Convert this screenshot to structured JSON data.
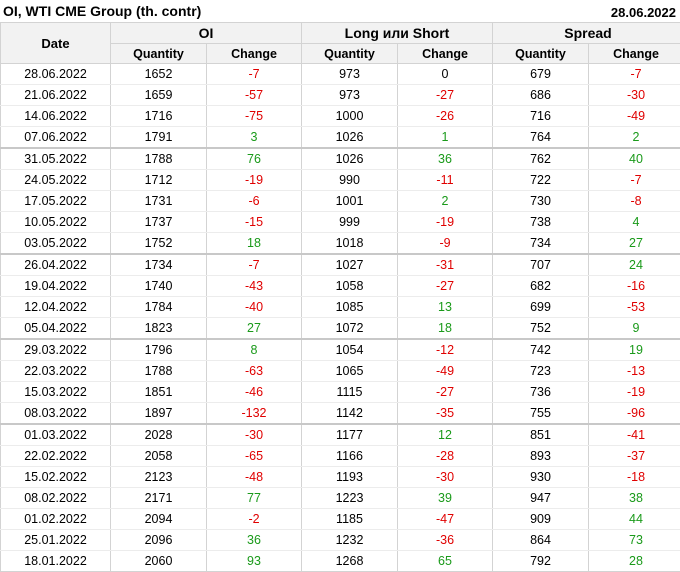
{
  "title": "OI, WTI CME Group (th. contr)",
  "date": "28.06.2022",
  "headers": {
    "date": "Date",
    "groups": [
      "OI",
      "Long или Short",
      "Spread"
    ],
    "quantity": "Quantity",
    "change": "Change"
  },
  "colors": {
    "positive": "#1a9a1a",
    "negative": "#e00000"
  },
  "rows": [
    {
      "date": "28.06.2022",
      "oi_q": "1652",
      "oi_c": "-7",
      "ls_q": "973",
      "ls_c": "0",
      "sp_q": "679",
      "sp_c": "-7"
    },
    {
      "date": "21.06.2022",
      "oi_q": "1659",
      "oi_c": "-57",
      "ls_q": "973",
      "ls_c": "-27",
      "sp_q": "686",
      "sp_c": "-30"
    },
    {
      "date": "14.06.2022",
      "oi_q": "1716",
      "oi_c": "-75",
      "ls_q": "1000",
      "ls_c": "-26",
      "sp_q": "716",
      "sp_c": "-49"
    },
    {
      "date": "07.06.2022",
      "oi_q": "1791",
      "oi_c": "3",
      "ls_q": "1026",
      "ls_c": "1",
      "sp_q": "764",
      "sp_c": "2"
    },
    {
      "date": "31.05.2022",
      "oi_q": "1788",
      "oi_c": "76",
      "ls_q": "1026",
      "ls_c": "36",
      "sp_q": "762",
      "sp_c": "40",
      "sep": true
    },
    {
      "date": "24.05.2022",
      "oi_q": "1712",
      "oi_c": "-19",
      "ls_q": "990",
      "ls_c": "-11",
      "sp_q": "722",
      "sp_c": "-7"
    },
    {
      "date": "17.05.2022",
      "oi_q": "1731",
      "oi_c": "-6",
      "ls_q": "1001",
      "ls_c": "2",
      "sp_q": "730",
      "sp_c": "-8"
    },
    {
      "date": "10.05.2022",
      "oi_q": "1737",
      "oi_c": "-15",
      "ls_q": "999",
      "ls_c": "-19",
      "sp_q": "738",
      "sp_c": "4"
    },
    {
      "date": "03.05.2022",
      "oi_q": "1752",
      "oi_c": "18",
      "ls_q": "1018",
      "ls_c": "-9",
      "sp_q": "734",
      "sp_c": "27"
    },
    {
      "date": "26.04.2022",
      "oi_q": "1734",
      "oi_c": "-7",
      "ls_q": "1027",
      "ls_c": "-31",
      "sp_q": "707",
      "sp_c": "24",
      "sep": true
    },
    {
      "date": "19.04.2022",
      "oi_q": "1740",
      "oi_c": "-43",
      "ls_q": "1058",
      "ls_c": "-27",
      "sp_q": "682",
      "sp_c": "-16"
    },
    {
      "date": "12.04.2022",
      "oi_q": "1784",
      "oi_c": "-40",
      "ls_q": "1085",
      "ls_c": "13",
      "sp_q": "699",
      "sp_c": "-53"
    },
    {
      "date": "05.04.2022",
      "oi_q": "1823",
      "oi_c": "27",
      "ls_q": "1072",
      "ls_c": "18",
      "sp_q": "752",
      "sp_c": "9"
    },
    {
      "date": "29.03.2022",
      "oi_q": "1796",
      "oi_c": "8",
      "ls_q": "1054",
      "ls_c": "-12",
      "sp_q": "742",
      "sp_c": "19",
      "sep": true
    },
    {
      "date": "22.03.2022",
      "oi_q": "1788",
      "oi_c": "-63",
      "ls_q": "1065",
      "ls_c": "-49",
      "sp_q": "723",
      "sp_c": "-13"
    },
    {
      "date": "15.03.2022",
      "oi_q": "1851",
      "oi_c": "-46",
      "ls_q": "1115",
      "ls_c": "-27",
      "sp_q": "736",
      "sp_c": "-19"
    },
    {
      "date": "08.03.2022",
      "oi_q": "1897",
      "oi_c": "-132",
      "ls_q": "1142",
      "ls_c": "-35",
      "sp_q": "755",
      "sp_c": "-96"
    },
    {
      "date": "01.03.2022",
      "oi_q": "2028",
      "oi_c": "-30",
      "ls_q": "1177",
      "ls_c": "12",
      "sp_q": "851",
      "sp_c": "-41",
      "sep": true
    },
    {
      "date": "22.02.2022",
      "oi_q": "2058",
      "oi_c": "-65",
      "ls_q": "1166",
      "ls_c": "-28",
      "sp_q": "893",
      "sp_c": "-37"
    },
    {
      "date": "15.02.2022",
      "oi_q": "2123",
      "oi_c": "-48",
      "ls_q": "1193",
      "ls_c": "-30",
      "sp_q": "930",
      "sp_c": "-18"
    },
    {
      "date": "08.02.2022",
      "oi_q": "2171",
      "oi_c": "77",
      "ls_q": "1223",
      "ls_c": "39",
      "sp_q": "947",
      "sp_c": "38"
    },
    {
      "date": "01.02.2022",
      "oi_q": "2094",
      "oi_c": "-2",
      "ls_q": "1185",
      "ls_c": "-47",
      "sp_q": "909",
      "sp_c": "44"
    },
    {
      "date": "25.01.2022",
      "oi_q": "2096",
      "oi_c": "36",
      "ls_q": "1232",
      "ls_c": "-36",
      "sp_q": "864",
      "sp_c": "73"
    },
    {
      "date": "18.01.2022",
      "oi_q": "2060",
      "oi_c": "93",
      "ls_q": "1268",
      "ls_c": "65",
      "sp_q": "792",
      "sp_c": "28"
    }
  ]
}
